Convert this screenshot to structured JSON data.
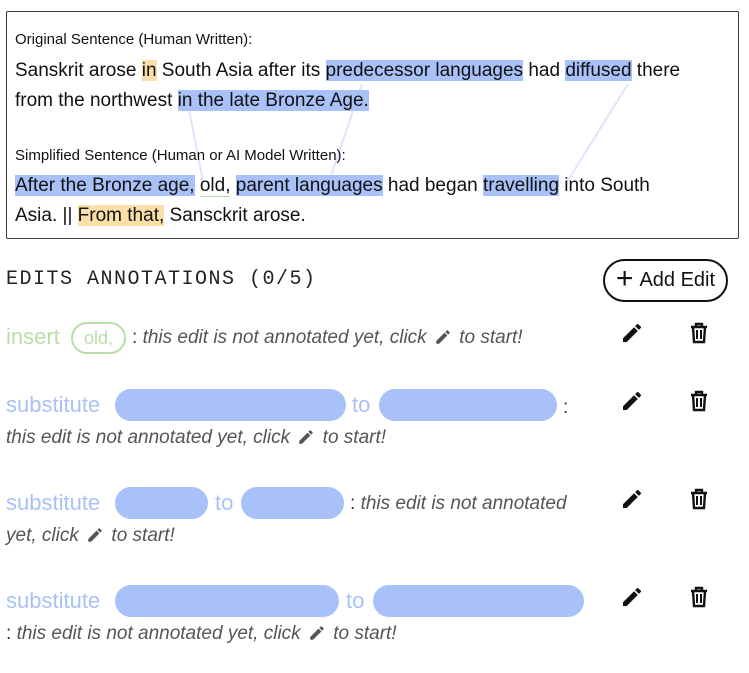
{
  "original": {
    "label": "Original Sentence (Human Written):",
    "line1": [
      {
        "text": "Sanskrit arose ",
        "hl": ""
      },
      {
        "text": "in",
        "hl": "orange"
      },
      {
        "text": " South Asia after its ",
        "hl": ""
      },
      {
        "text": "predecessor languages",
        "hl": "blue"
      },
      {
        "text": " had ",
        "hl": ""
      },
      {
        "text": "diffused",
        "hl": "blue"
      },
      {
        "text": " there",
        "hl": ""
      }
    ],
    "line2": [
      {
        "text": "from the northwest ",
        "hl": ""
      },
      {
        "text": "in the late Bronze Age.",
        "hl": "blue"
      }
    ]
  },
  "simplified": {
    "label": "Simplified Sentence (Human or AI Model Written):",
    "line1": [
      {
        "text": "After the Bronze age,",
        "hl": "blue"
      },
      {
        "text": " ",
        "hl": ""
      },
      {
        "text": "old,",
        "hl": "green"
      },
      {
        "text": " ",
        "hl": ""
      },
      {
        "text": "parent languages",
        "hl": "blue"
      },
      {
        "text": " had began ",
        "hl": ""
      },
      {
        "text": "travelling",
        "hl": "blue"
      },
      {
        "text": " into South",
        "hl": ""
      }
    ],
    "line2": [
      {
        "text": "Asia. || ",
        "hl": ""
      },
      {
        "text": "From that,",
        "hl": "orange"
      },
      {
        "text": " Sansckrit arose.",
        "hl": ""
      }
    ]
  },
  "annotations": {
    "title": "EDITS ANNOTATIONS (0/5)",
    "add_button_label": "Add Edit",
    "to_word": "to",
    "not_annotated_prefix": "this edit is not annotated yet, click",
    "not_annotated_suffix": "to start!",
    "edits": [
      {
        "type": "insert",
        "pill": "old,"
      },
      {
        "type": "substitute"
      },
      {
        "type": "substitute",
        "note_line1": "this edit is not annotated",
        "note_line2_prefix": "yet, click"
      },
      {
        "type": "substitute"
      }
    ]
  },
  "colors": {
    "blue_highlight": "#a9c1f9",
    "orange_highlight": "#fbdfa9",
    "insert_green": "#b9dea8"
  }
}
